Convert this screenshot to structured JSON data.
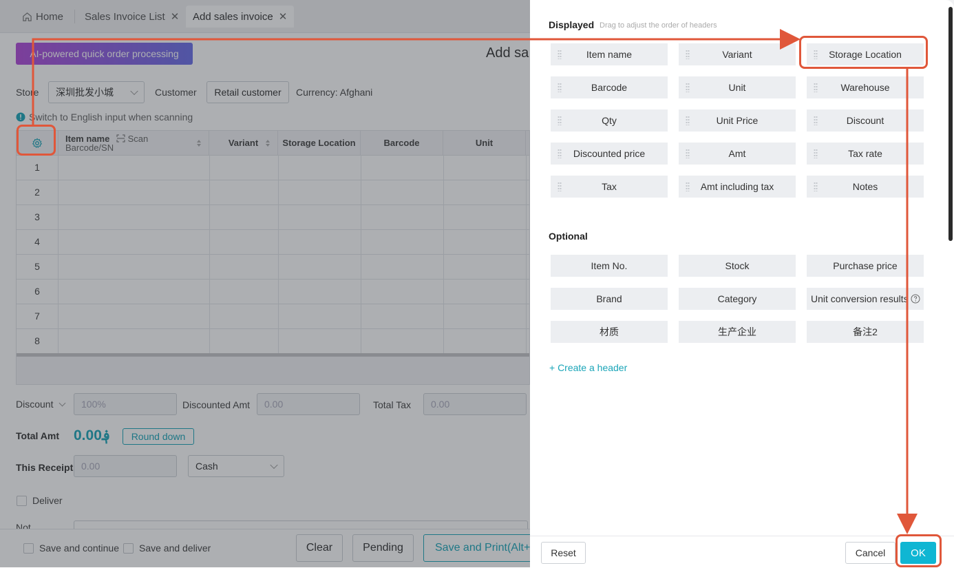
{
  "tabs": [
    {
      "label": "Home",
      "icon": "home-icon"
    },
    {
      "label": "Sales Invoice List",
      "close": "✕"
    },
    {
      "label": "Add sales invoice",
      "close": "✕"
    }
  ],
  "ai_button": "AI-powered quick order processing",
  "page_title": "Add sa",
  "form": {
    "store_label": "Store",
    "store_value": "深圳批发小城",
    "customer_label": "Customer",
    "customer_value": "Retail customer",
    "currency": "Currency: Afghani",
    "scan_hint": "Switch to English input when scanning"
  },
  "table": {
    "headers": {
      "item_name": "Item name",
      "scan": "Scan",
      "barcode_sn": "Barcode/SN",
      "variant": "Variant",
      "storage_location": "Storage Location",
      "barcode": "Barcode",
      "unit": "Unit"
    },
    "rows": [
      "1",
      "2",
      "3",
      "4",
      "5",
      "6",
      "7",
      "8"
    ]
  },
  "summary": {
    "discount_label": "Discount",
    "discount_value": "100%",
    "discounted_amt_label": "Discounted Amt",
    "discounted_amt_value": "0.00",
    "total_tax_label": "Total Tax",
    "total_tax_value": "0.00",
    "total_amt_label": "Total Amt",
    "total_amt_value": "0.00؋",
    "round_down": "Round down",
    "receipt_label": "This Receipt",
    "receipt_value": "0.00",
    "payment_method": "Cash",
    "deliver_label": "Deliver",
    "notes_label": "Not"
  },
  "bottom": {
    "save_continue": "Save and continue",
    "save_deliver": "Save and deliver",
    "clear": "Clear",
    "pending": "Pending",
    "save_print": "Save and Print(Alt+"
  },
  "drawer": {
    "displayed_title": "Displayed",
    "displayed_hint": "Drag to adjust the order of headers",
    "displayed": [
      "Item name",
      "Variant",
      "Storage Location",
      "Barcode",
      "Unit",
      "Warehouse",
      "Qty",
      "Unit Price",
      "Discount",
      "Discounted price",
      "Amt",
      "Tax rate",
      "Tax",
      "Amt including tax",
      "Notes"
    ],
    "optional_title": "Optional",
    "optional": [
      "Item No.",
      "Stock",
      "Purchase price",
      "Brand",
      "Category",
      "Unit conversion results",
      "材质",
      "生产企业",
      "备注2"
    ],
    "create_header": "+ Create a header",
    "reset": "Reset",
    "cancel": "Cancel",
    "ok": "OK"
  },
  "colors": {
    "accent": "#0fb6d3",
    "highlight": "#e0573a",
    "ai_gradient_start": "#b04ad9",
    "ai_gradient_end": "#6a6fe8"
  }
}
